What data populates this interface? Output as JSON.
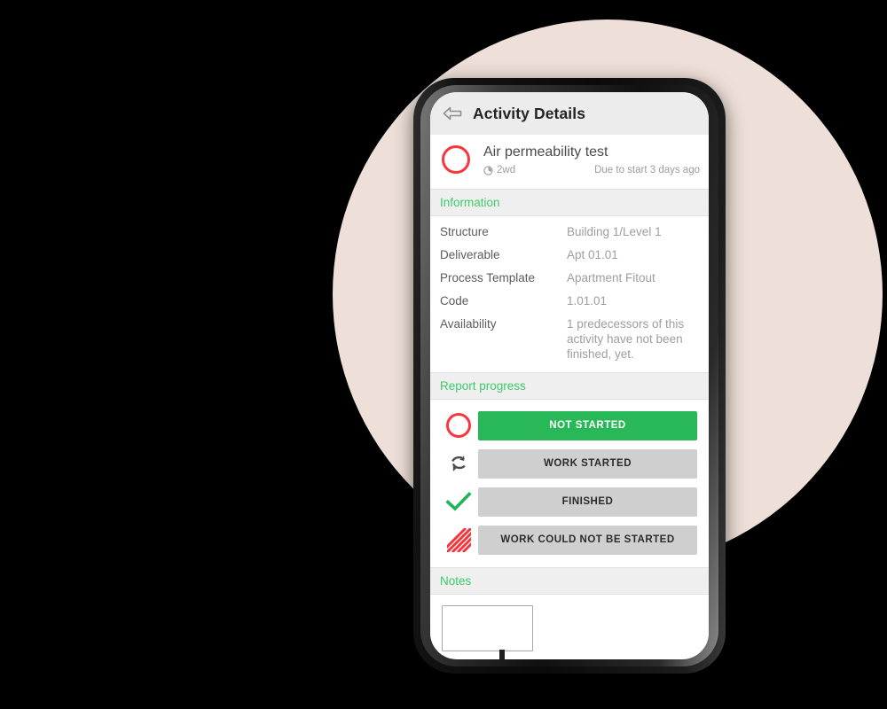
{
  "background": {
    "canvas_color": "#000000",
    "circle_color": "#EEE0D8"
  },
  "theme": {
    "accent_green": "#3ECB6C",
    "button_green": "#28B857",
    "status_red": "#F8363B",
    "button_gray": "#CFCFCF",
    "section_bg": "#EFEFEF",
    "appbar_bg": "#ECECEC"
  },
  "appbar": {
    "back_icon": "back-arrow-icon",
    "title": "Activity Details"
  },
  "activity": {
    "status_icon": "circle-outline-icon",
    "name": "Air permeability test",
    "duration_icon": "clock-icon",
    "duration": "2wd",
    "due": "Due to start 3 days ago"
  },
  "information": {
    "header": "Information",
    "rows": [
      {
        "label": "Structure",
        "value": "Building 1/Level 1"
      },
      {
        "label": "Deliverable",
        "value": "Apt 01.01"
      },
      {
        "label": "Process Template",
        "value": "Apartment Fitout"
      },
      {
        "label": "Code",
        "value": "1.01.01"
      },
      {
        "label": "Availability",
        "value": "1 predecessors of this activity have not been finished, yet."
      }
    ]
  },
  "report_progress": {
    "header": "Report progress",
    "options": [
      {
        "icon": "circle-outline-icon",
        "label": "NOT STARTED",
        "selected": true
      },
      {
        "icon": "refresh-arrows-icon",
        "label": "WORK STARTED",
        "selected": false
      },
      {
        "icon": "checkmark-icon",
        "label": "FINISHED",
        "selected": false
      },
      {
        "icon": "hatched-square-icon",
        "label": "WORK COULD NOT BE STARTED",
        "selected": false
      }
    ]
  },
  "notes": {
    "header": "Notes",
    "input_value": "",
    "input_placeholder": ""
  }
}
